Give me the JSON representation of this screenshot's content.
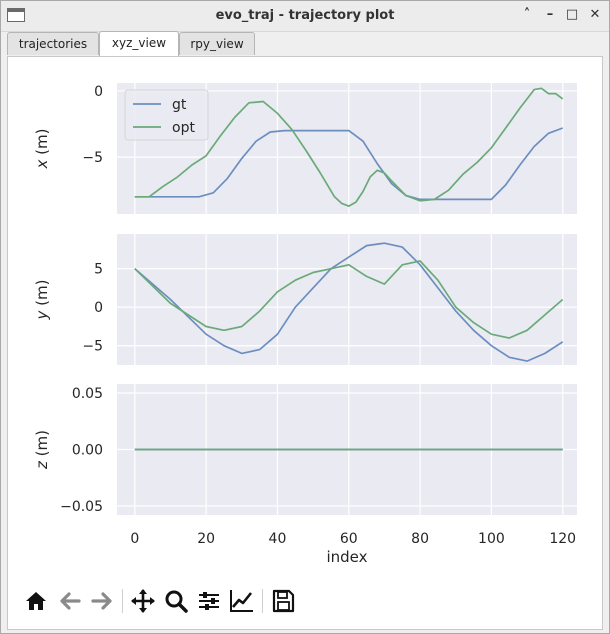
{
  "window": {
    "title": "evo_traj - trajectory plot"
  },
  "tabs": [
    {
      "label": "trajectories",
      "active": false
    },
    {
      "label": "xyz_view",
      "active": true
    },
    {
      "label": "rpy_view",
      "active": false
    }
  ],
  "toolbar": {
    "icons": [
      "home-icon",
      "back-arrow-icon",
      "forward-arrow-icon",
      "pan-icon",
      "zoom-icon",
      "subplots-config-icon",
      "edit-axis-icon",
      "save-icon"
    ]
  },
  "colors": {
    "gt": "#6c8ebf",
    "opt": "#6aaa78",
    "axes_bg": "#eaeaf2"
  },
  "chart_data": [
    {
      "type": "line",
      "title": "",
      "xlabel": "",
      "ylabel": "x (m)",
      "xlim": [
        -5,
        124
      ],
      "ylim": [
        -9.3,
        0.6
      ],
      "yticks": [
        0,
        -5
      ],
      "legend": {
        "placement": "top-left",
        "entries": [
          "gt",
          "opt"
        ]
      },
      "series": [
        {
          "name": "gt",
          "x": [
            0,
            18,
            22,
            26,
            30,
            34,
            38,
            42,
            60,
            64,
            68,
            72,
            76,
            80,
            84,
            100,
            104,
            108,
            112,
            116,
            120
          ],
          "y": [
            -8,
            -8,
            -7.7,
            -6.6,
            -5.1,
            -3.8,
            -3.1,
            -3,
            -3,
            -3.8,
            -5.5,
            -7,
            -7.9,
            -8.2,
            -8.2,
            -8.2,
            -7.1,
            -5.6,
            -4.2,
            -3.2,
            -2.8
          ]
        },
        {
          "name": "opt",
          "x": [
            0,
            4,
            8,
            12,
            16,
            20,
            24,
            28,
            32,
            36,
            40,
            44,
            48,
            52,
            56,
            58,
            60,
            62,
            64,
            66,
            68,
            70,
            72,
            76,
            80,
            84,
            88,
            92,
            96,
            100,
            104,
            108,
            112,
            114,
            116,
            118,
            120
          ],
          "y": [
            -8,
            -8,
            -7.2,
            -6.5,
            -5.6,
            -4.9,
            -3.4,
            -2,
            -0.9,
            -0.8,
            -1.7,
            -2.9,
            -4.5,
            -6.2,
            -8,
            -8.5,
            -8.7,
            -8.4,
            -7.6,
            -6.5,
            -6,
            -6.2,
            -6.8,
            -7.9,
            -8.3,
            -8.2,
            -7.5,
            -6.3,
            -5.4,
            -4.3,
            -2.8,
            -1.3,
            0.1,
            0.2,
            -0.2,
            -0.2,
            -0.6
          ]
        }
      ]
    },
    {
      "type": "line",
      "title": "",
      "xlabel": "",
      "ylabel": "y (m)",
      "xlim": [
        -5,
        124
      ],
      "ylim": [
        -7.5,
        9.5
      ],
      "yticks": [
        5,
        0,
        -5
      ],
      "series": [
        {
          "name": "gt",
          "x": [
            0,
            10,
            20,
            25,
            30,
            35,
            40,
            45,
            50,
            55,
            60,
            65,
            70,
            75,
            80,
            85,
            90,
            95,
            100,
            105,
            110,
            115,
            120
          ],
          "y": [
            5,
            1,
            -3.5,
            -5,
            -6,
            -5.5,
            -3.5,
            0,
            2.5,
            5,
            6.5,
            8,
            8.3,
            7.8,
            5.5,
            2.5,
            -0.5,
            -3,
            -5,
            -6.5,
            -7,
            -6,
            -4.5
          ]
        },
        {
          "name": "opt",
          "x": [
            0,
            10,
            20,
            25,
            30,
            35,
            40,
            45,
            50,
            55,
            60,
            65,
            70,
            75,
            80,
            85,
            90,
            95,
            100,
            105,
            110,
            115,
            120
          ],
          "y": [
            5,
            0.5,
            -2.5,
            -3,
            -2.5,
            -0.5,
            2,
            3.5,
            4.5,
            5,
            5.5,
            4,
            3,
            5.5,
            6,
            3.5,
            0,
            -2,
            -3.5,
            -4,
            -3,
            -1,
            1
          ]
        }
      ]
    },
    {
      "type": "line",
      "title": "",
      "xlabel": "index",
      "ylabel": "z (m)",
      "xlim": [
        -5,
        124
      ],
      "ylim": [
        -0.058,
        0.058
      ],
      "yticks": [
        "0.05",
        "0.00",
        "−0.05"
      ],
      "yticks_values": [
        0.05,
        0,
        -0.05
      ],
      "xticks": [
        0,
        20,
        40,
        60,
        80,
        100,
        120
      ],
      "series": [
        {
          "name": "gt",
          "x": [
            0,
            120
          ],
          "y": [
            0,
            0
          ]
        },
        {
          "name": "opt",
          "x": [
            0,
            120
          ],
          "y": [
            0,
            0
          ]
        }
      ]
    }
  ]
}
